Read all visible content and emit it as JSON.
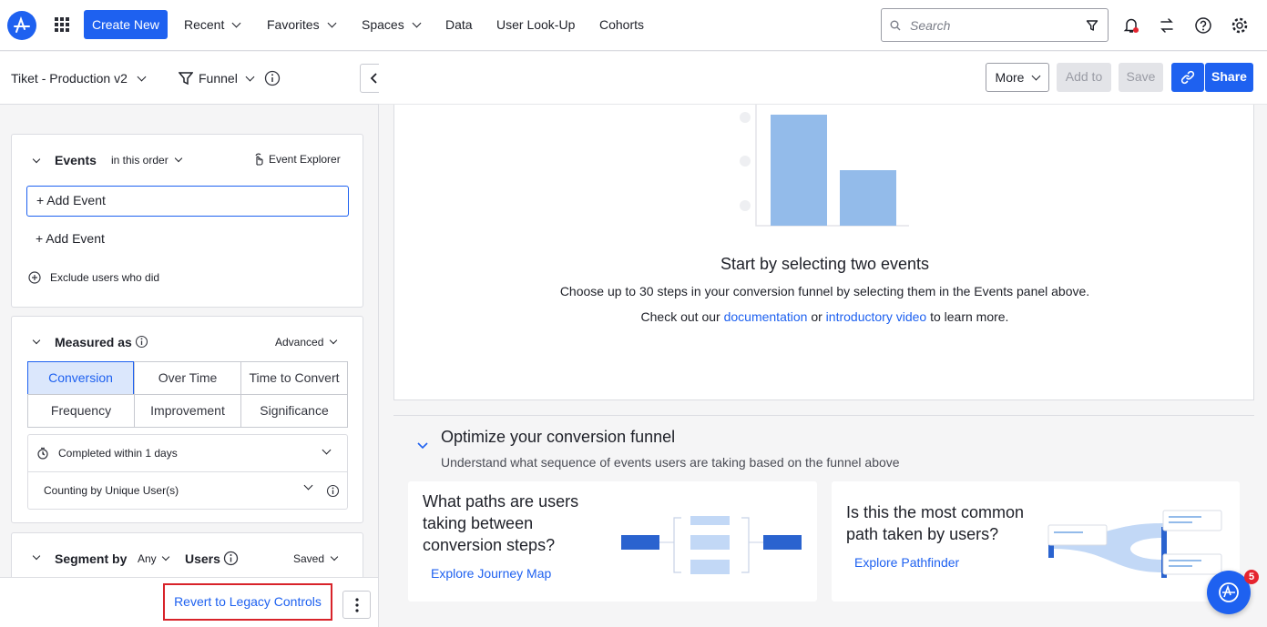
{
  "topbar": {
    "create_label": "Create New",
    "nav": [
      {
        "label": "Recent"
      },
      {
        "label": "Favorites"
      },
      {
        "label": "Spaces"
      },
      {
        "label": "Data"
      },
      {
        "label": "User Look-Up"
      },
      {
        "label": "Cohorts"
      }
    ],
    "search_placeholder": "Search"
  },
  "left": {
    "project": "Tiket - Production v2",
    "chart_type": "Funnel",
    "events": {
      "title": "Events",
      "order": "in this order",
      "explorer": "Event Explorer",
      "add_event_input": "+ Add Event",
      "add_event_2": "+ Add Event",
      "exclude": "Exclude users who did"
    },
    "measured": {
      "title": "Measured as",
      "advanced": "Advanced",
      "options": [
        "Conversion",
        "Over Time",
        "Time to Convert",
        "Frequency",
        "Improvement",
        "Significance"
      ],
      "completed": "Completed within 1 days",
      "counting": "Counting by Unique User(s)"
    },
    "segment": {
      "title": "Segment by",
      "any": "Any",
      "users": "Users",
      "saved": "Saved"
    },
    "revert_label": "Revert to Legacy Controls"
  },
  "header": {
    "more": "More",
    "add_to": "Add to",
    "save": "Save",
    "share": "Share"
  },
  "empty_state": {
    "title": "Start by selecting two events",
    "line1": "Choose up to 30 steps in your conversion funnel by selecting them in the Events panel above.",
    "line2_a": "Check out our ",
    "doc_link": "documentation",
    "line2_b": " or ",
    "video_link": "introductory video",
    "line2_c": " to learn more."
  },
  "optimize": {
    "title": "Optimize your conversion funnel",
    "subtitle": "Understand what sequence of events users are taking based on the funnel above",
    "card1": {
      "title": "What paths are users taking between conversion steps?",
      "link": "Explore Journey Map"
    },
    "card2": {
      "title": "Is this the most common path taken by users?",
      "link": "Explore Pathfinder"
    }
  },
  "notification_count": "5",
  "colors": {
    "accent": "#1e61f0",
    "bar": "#93bbea"
  }
}
